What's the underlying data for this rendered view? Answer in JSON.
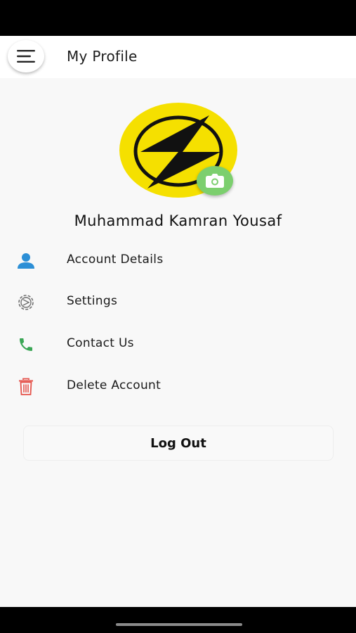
{
  "header": {
    "title": "My Profile",
    "menu_icon": "hamburger-menu-icon"
  },
  "profile": {
    "name": "Muhammad Kamran Yousaf",
    "avatar_icon": "lightning-logo",
    "camera_icon": "camera-icon",
    "colors": {
      "avatar_bg": "#f5e000",
      "camera_bg": "#7ccf6e"
    }
  },
  "menu": {
    "items": [
      {
        "label": "Account Details",
        "icon": "user-icon",
        "icon_color": "#2c8fd6"
      },
      {
        "label": "Settings",
        "icon": "gear-icon",
        "icon_color": "#6f6f6f"
      },
      {
        "label": "Contact Us",
        "icon": "phone-icon",
        "icon_color": "#3aa655"
      },
      {
        "label": "Delete Account",
        "icon": "trash-icon",
        "icon_color": "#e5534b"
      }
    ]
  },
  "logout": {
    "label": "Log Out"
  }
}
